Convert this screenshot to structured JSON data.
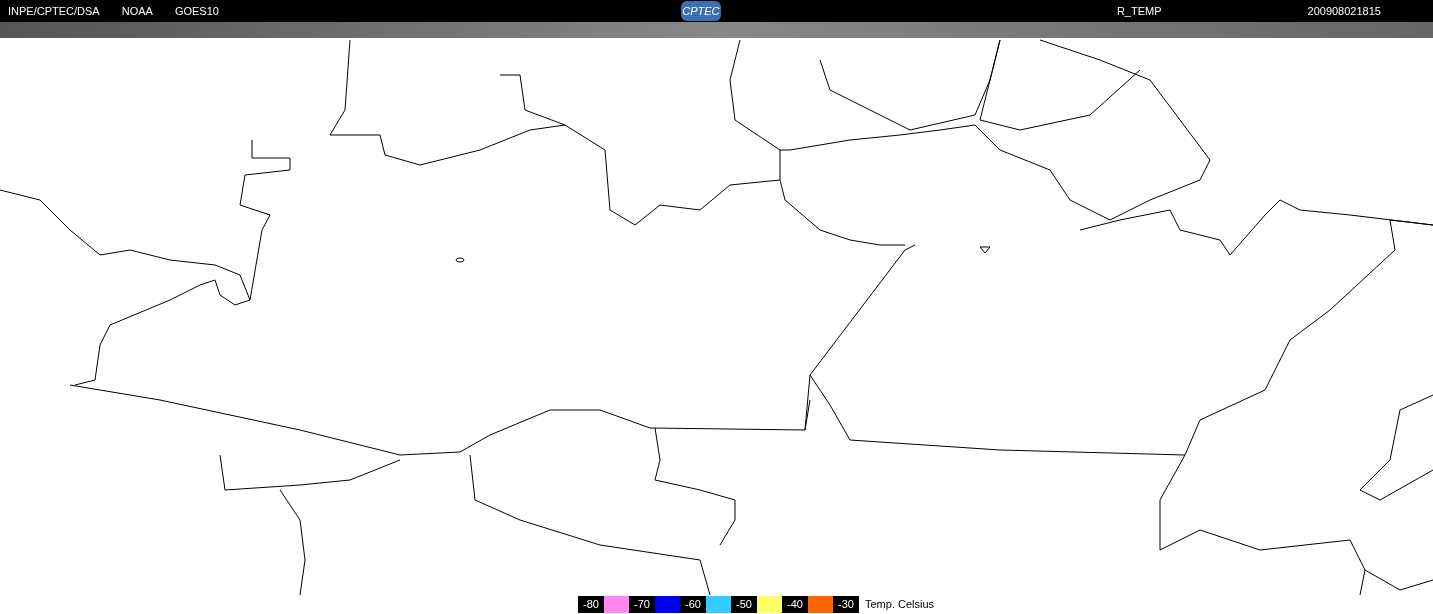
{
  "header": {
    "left_labels": [
      "INPE/CPTEC/DSA",
      "NOAA",
      "GOES10"
    ],
    "logo": "CPTEC",
    "product": "R_TEMP",
    "timestamp": "200908021815"
  },
  "legend": {
    "items": [
      {
        "kind": "label",
        "text": "-80"
      },
      {
        "kind": "swatch",
        "color": "#ff88ee"
      },
      {
        "kind": "label",
        "text": "-70"
      },
      {
        "kind": "swatch",
        "color": "#0000f0"
      },
      {
        "kind": "label",
        "text": "-60"
      },
      {
        "kind": "swatch",
        "color": "#33ccff"
      },
      {
        "kind": "label",
        "text": "-50"
      },
      {
        "kind": "swatch",
        "color": "#ffff66"
      },
      {
        "kind": "label",
        "text": "-40"
      },
      {
        "kind": "swatch",
        "color": "#ff6600"
      },
      {
        "kind": "label",
        "text": "-30"
      }
    ],
    "caption": "Temp. Celsius"
  }
}
